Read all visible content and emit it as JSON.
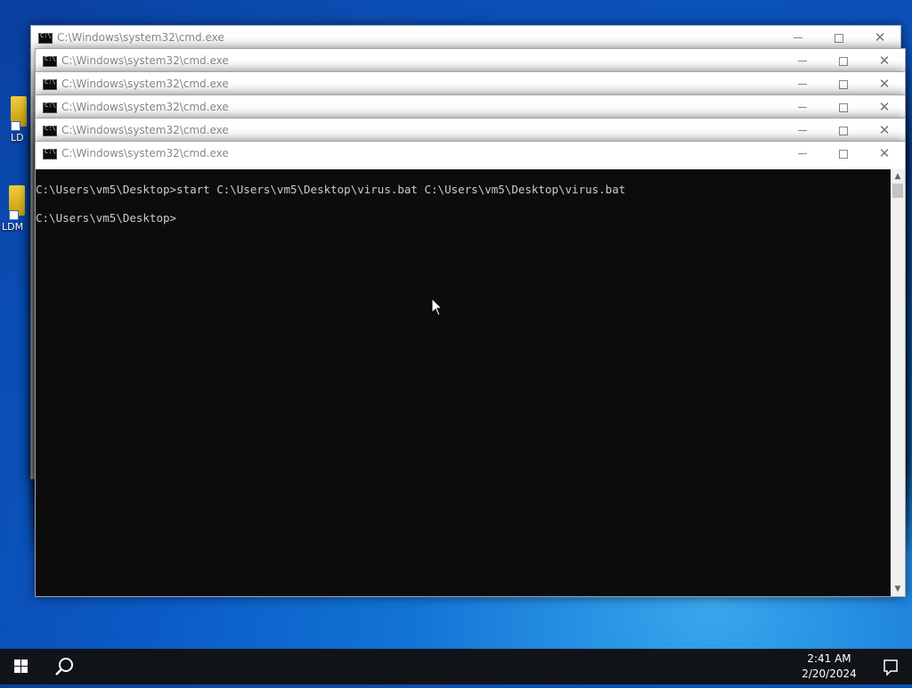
{
  "desktop": {
    "icons": [
      {
        "label": "LD"
      },
      {
        "label": "LDM"
      }
    ]
  },
  "windows": [
    {
      "title": "C:\\Windows\\system32\\cmd.exe"
    },
    {
      "title": "C:\\Windows\\system32\\cmd.exe"
    },
    {
      "title": "C:\\Windows\\system32\\cmd.exe"
    },
    {
      "title": "C:\\Windows\\system32\\cmd.exe"
    },
    {
      "title": "C:\\Windows\\system32\\cmd.exe"
    },
    {
      "title": "C:\\Windows\\system32\\cmd.exe"
    }
  ],
  "console": {
    "line1": "C:\\Users\\vm5\\Desktop>start C:\\Users\\vm5\\Desktop\\virus.bat C:\\Users\\vm5\\Desktop\\virus.bat",
    "line2": "C:\\Users\\vm5\\Desktop>"
  },
  "taskbar": {
    "time": "2:41 AM",
    "date": "2/20/2024",
    "start_icon": "windows-logo-icon",
    "search_icon": "search-icon",
    "notification_icon": "notification-icon"
  },
  "colors": {
    "console_bg": "#0c0c0c",
    "console_text": "#cccccc",
    "taskbar_bg": "#101418",
    "desktop_accent": "#1274d6"
  }
}
